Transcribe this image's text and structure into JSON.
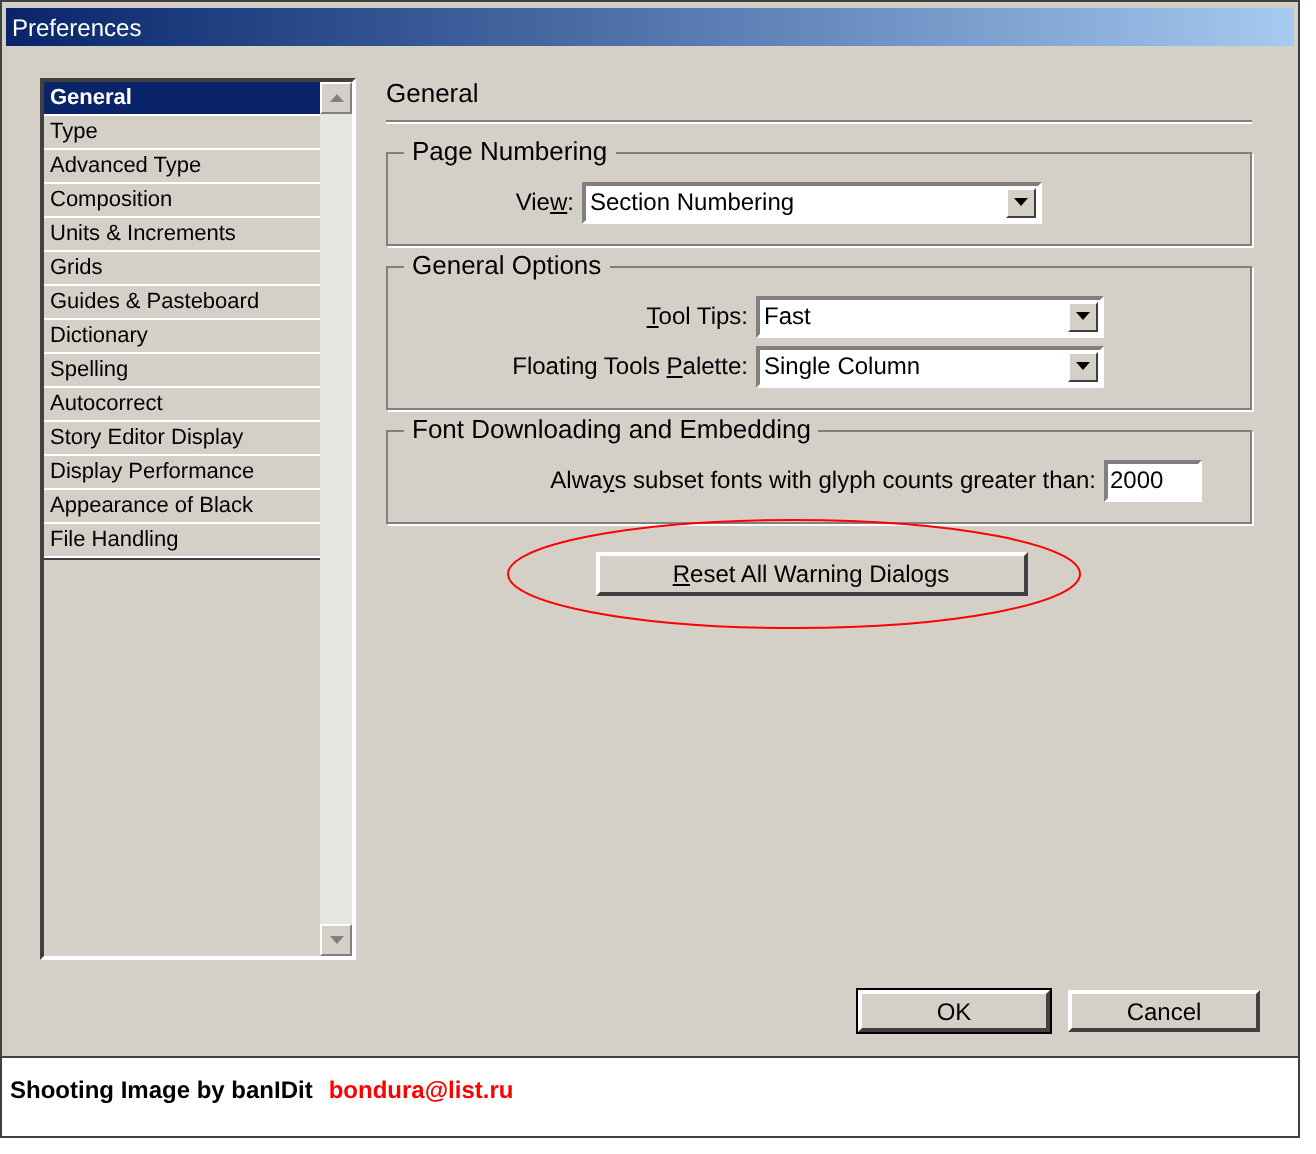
{
  "window": {
    "title": "Preferences"
  },
  "sidebar": {
    "items": [
      {
        "label": "General",
        "selected": true
      },
      {
        "label": "Type",
        "selected": false
      },
      {
        "label": "Advanced Type",
        "selected": false
      },
      {
        "label": "Composition",
        "selected": false
      },
      {
        "label": "Units & Increments",
        "selected": false
      },
      {
        "label": "Grids",
        "selected": false
      },
      {
        "label": "Guides & Pasteboard",
        "selected": false
      },
      {
        "label": "Dictionary",
        "selected": false
      },
      {
        "label": "Spelling",
        "selected": false
      },
      {
        "label": "Autocorrect",
        "selected": false
      },
      {
        "label": "Story Editor Display",
        "selected": false
      },
      {
        "label": "Display Performance",
        "selected": false
      },
      {
        "label": "Appearance of Black",
        "selected": false
      },
      {
        "label": "File Handling",
        "selected": false
      }
    ]
  },
  "panel": {
    "title": "General",
    "groups": [
      {
        "title": "Page Numbering",
        "fields": [
          {
            "kind": "dropdown",
            "label_parts": {
              "before": "Vie",
              "key": "w",
              "after": ":"
            },
            "value": "Section Numbering"
          }
        ]
      },
      {
        "title": "General Options",
        "fields": [
          {
            "kind": "dropdown",
            "label_parts": {
              "key": "T",
              "after": "ool Tips:"
            },
            "value": "Fast"
          },
          {
            "kind": "dropdown",
            "label_parts": {
              "before": "Floating Tools ",
              "key": "P",
              "after": "alette:"
            },
            "value": "Single Column"
          }
        ]
      },
      {
        "title": "Font Downloading and Embedding",
        "fields": [
          {
            "kind": "text",
            "label_parts": {
              "before": "Alwa",
              "key": "y",
              "after": "s subset fonts with glyph counts greater than:"
            },
            "value": "2000"
          }
        ]
      }
    ],
    "reset_button": {
      "label_parts": {
        "key": "R",
        "after": "eset All Warning Dialogs"
      }
    }
  },
  "buttons": [
    "OK",
    "Cancel"
  ],
  "footer": {
    "credit": "Shooting Image by banIDit",
    "email": "bondura@list.ru"
  }
}
